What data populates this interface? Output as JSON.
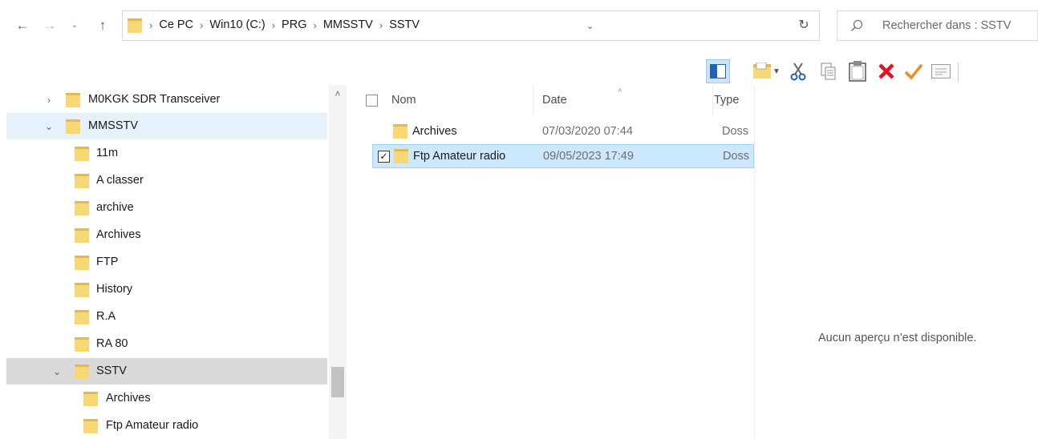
{
  "address": {
    "crumbs": [
      "Ce PC",
      "Win10 (C:)",
      "PRG",
      "MMSSTV",
      "SSTV"
    ],
    "search_placeholder": "Rechercher dans : SSTV"
  },
  "toolbar": {
    "items": [
      "preview-pane-icon",
      "new-folder-icon",
      "cut-icon",
      "copy-icon",
      "paste-icon",
      "delete-icon",
      "checkmark-icon",
      "properties-icon"
    ]
  },
  "tree": {
    "items": [
      {
        "label": "M0KGK SDR Transceiver",
        "level": 0,
        "expander": "collapsed"
      },
      {
        "label": "MMSSTV",
        "level": 0,
        "expander": "expanded"
      },
      {
        "label": "11m",
        "level": 1
      },
      {
        "label": "A classer",
        "level": 1
      },
      {
        "label": "archive",
        "level": 1
      },
      {
        "label": "Archives",
        "level": 1
      },
      {
        "label": "FTP",
        "level": 1
      },
      {
        "label": "History",
        "level": 1
      },
      {
        "label": "R.A",
        "level": 1
      },
      {
        "label": "RA 80",
        "level": 1
      },
      {
        "label": "SSTV",
        "level": 1,
        "expander": "expanded"
      },
      {
        "label": "Archives",
        "level": 2
      },
      {
        "label": "Ftp Amateur radio",
        "level": 2
      }
    ]
  },
  "columns": {
    "name": "Nom",
    "date": "Date",
    "type": "Type"
  },
  "files": [
    {
      "name": "Archives",
      "date": "07/03/2020 07:44",
      "type": "Doss",
      "selected": false
    },
    {
      "name": "Ftp Amateur radio",
      "date": "09/05/2023 17:49",
      "type": "Doss",
      "selected": true
    }
  ],
  "preview": {
    "message": "Aucun aperçu n’est disponible."
  },
  "colors": {
    "folder": "#f8d775",
    "folder_dark": "#e8b94a",
    "selection": "#cce8ff",
    "tree_selected": "#e5f1fb",
    "tree_current": "#d9d9d9",
    "delete": "#e81123",
    "check": "#f08a24"
  }
}
